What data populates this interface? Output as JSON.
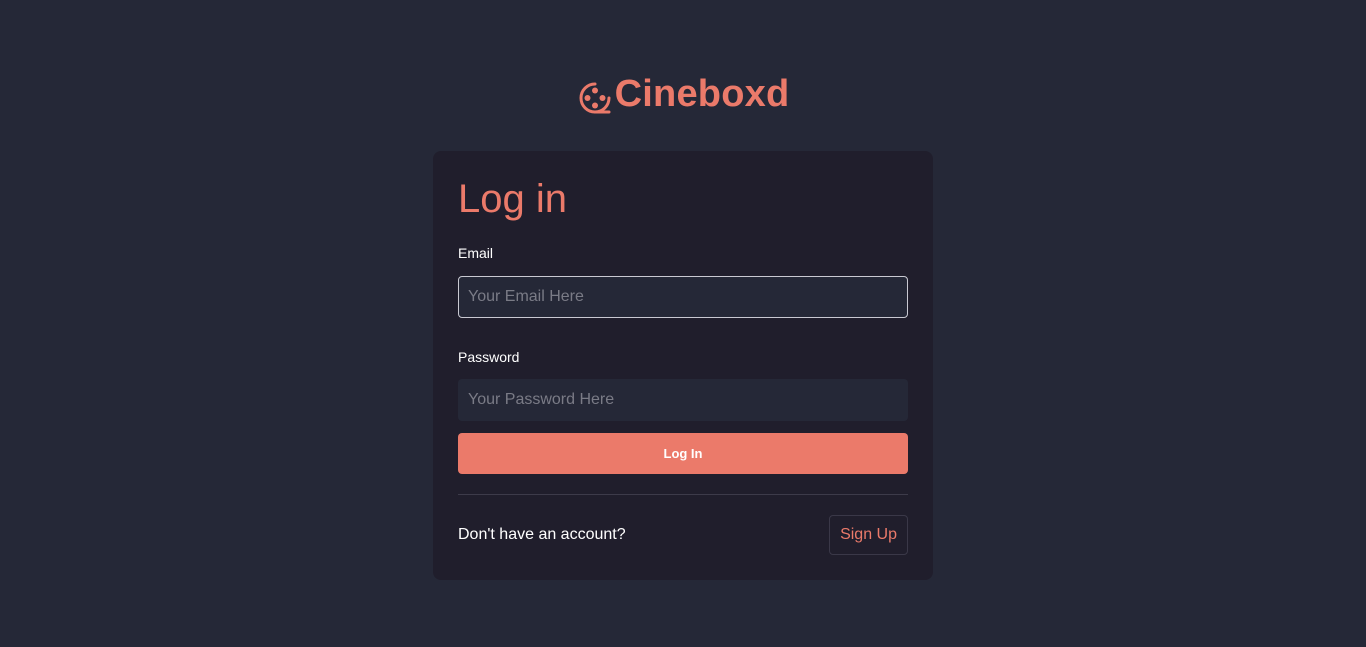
{
  "colors": {
    "background": "#252837",
    "card": "#201e2c",
    "accent": "#eb7a6a",
    "input_background": "#252837",
    "text": "#ffffff",
    "placeholder": "#7a7b86"
  },
  "brand": {
    "icon": "film-reel-icon",
    "name": "Cineboxd"
  },
  "login_form": {
    "title": "Log in",
    "email": {
      "label": "Email",
      "value": "",
      "placeholder": "Your Email Here"
    },
    "password": {
      "label": "Password",
      "value": "",
      "placeholder": "Your Password Here"
    },
    "submit_label": "Log In"
  },
  "signup": {
    "prompt": "Don't have an account?",
    "button_label": "Sign Up"
  }
}
